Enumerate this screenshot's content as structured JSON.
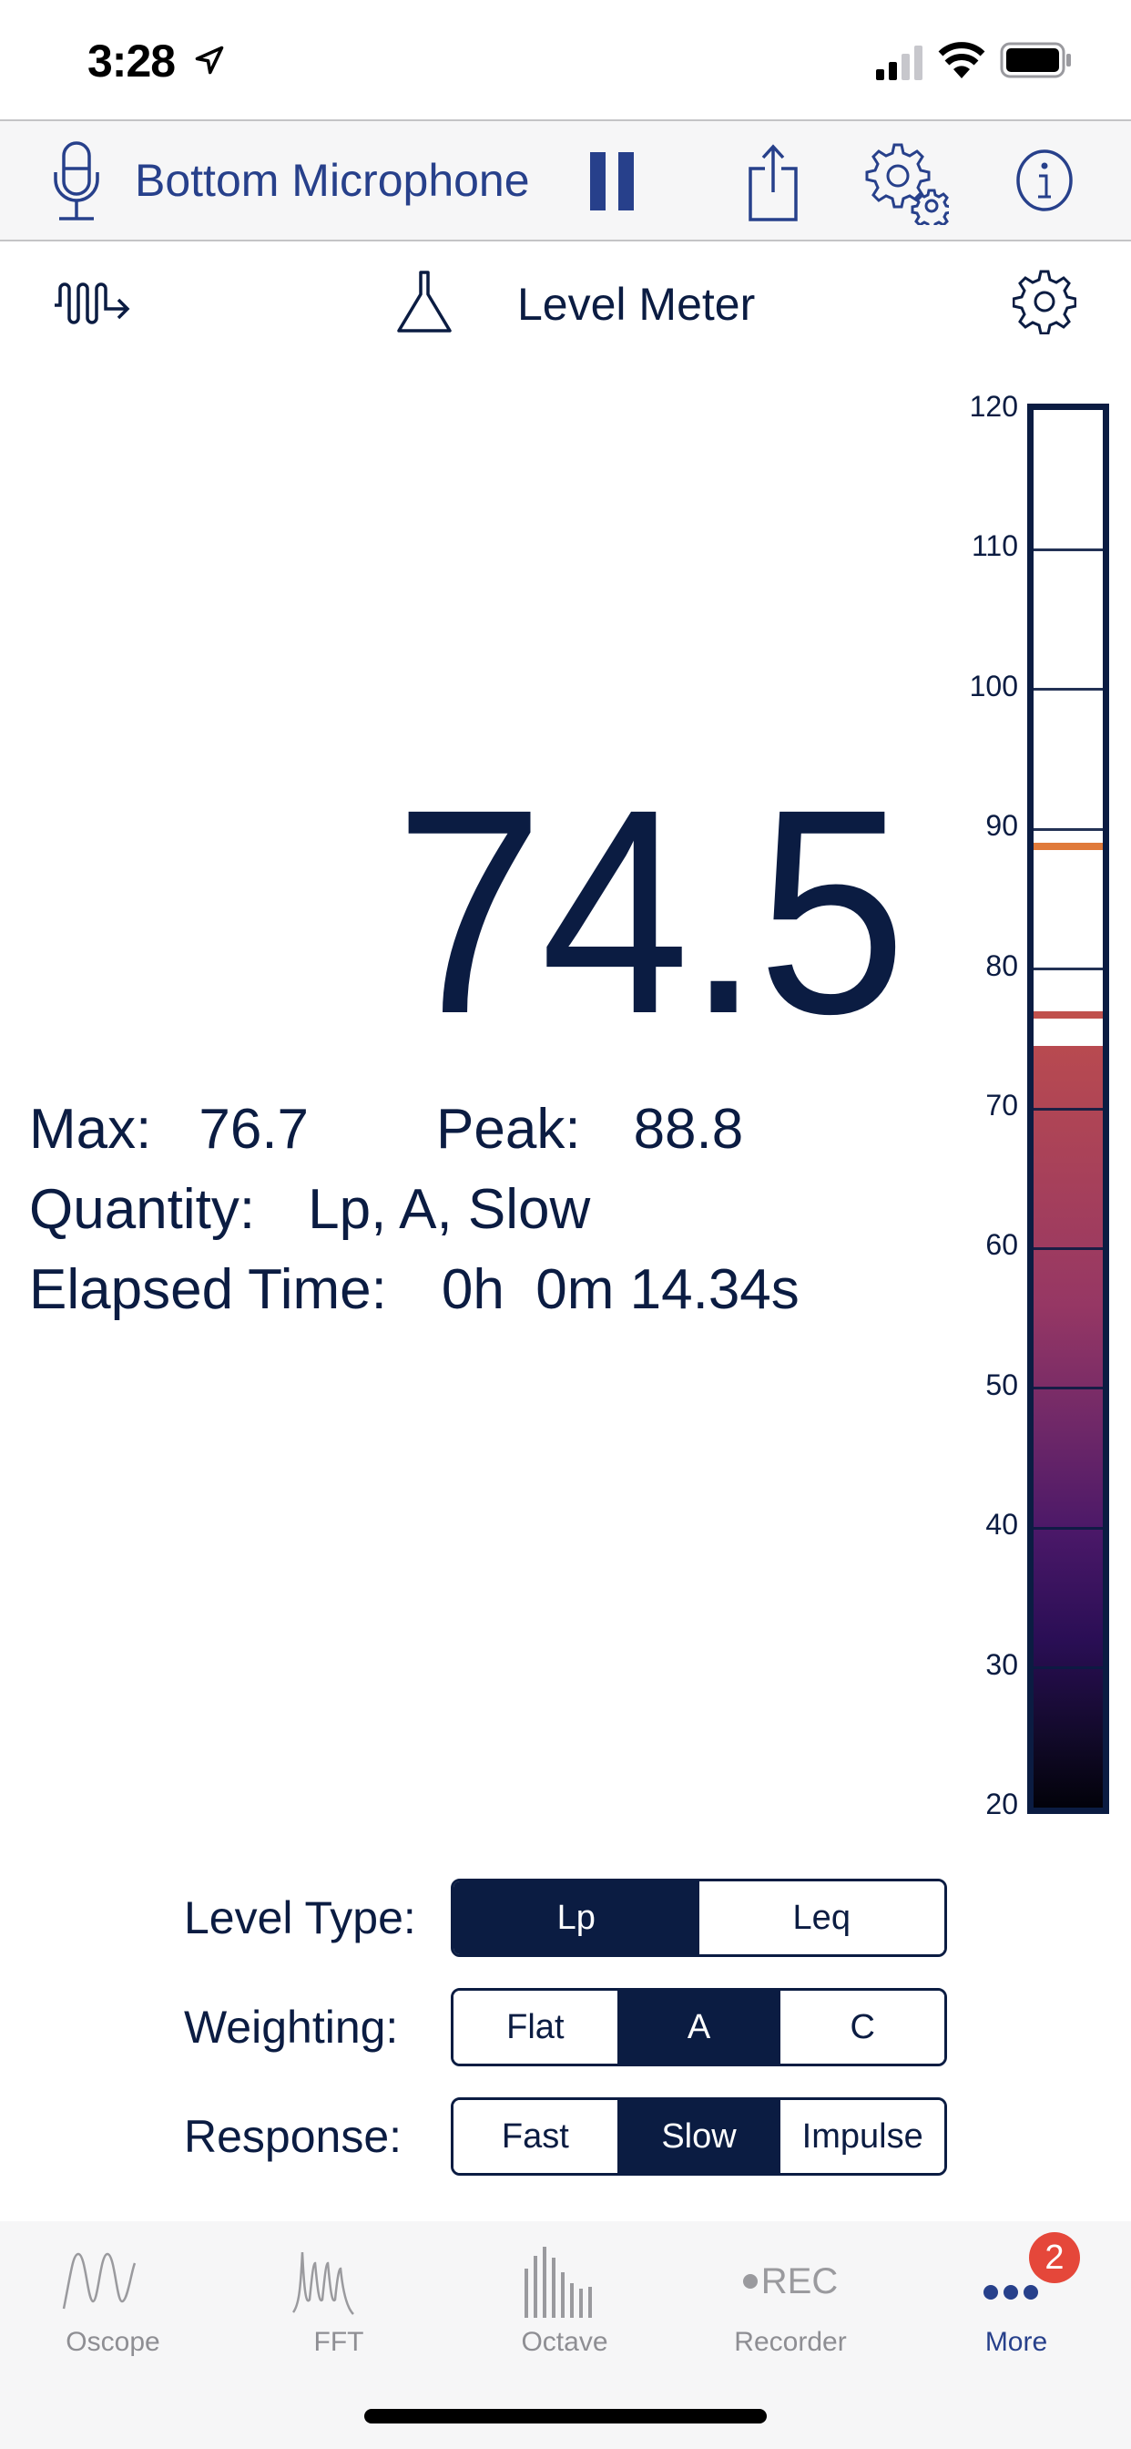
{
  "status_bar": {
    "time": "3:28"
  },
  "toolbar": {
    "input_source": "Bottom Microphone",
    "accent_color": "#27408b"
  },
  "subheader": {
    "title": "Level Meter"
  },
  "reading": {
    "value": "74.5"
  },
  "stats": {
    "max_label": "Max:",
    "max_value": "76.7",
    "peak_label": "Peak:",
    "peak_value": "88.8",
    "quantity_label": "Quantity:",
    "quantity_value": "Lp, A, Slow",
    "elapsed_label": "Elapsed Time:",
    "elapsed_value": "0h  0m 14.34s"
  },
  "meter": {
    "min": 20,
    "max": 120,
    "current": 74.5,
    "max_marker": 76.7,
    "peak_marker": 88.8,
    "max_marker_color": "#c0514d",
    "peak_marker_color": "#e07a3a",
    "ticks": [
      "120",
      "110",
      "100",
      "90",
      "80",
      "70",
      "60",
      "50",
      "40",
      "30",
      "20"
    ]
  },
  "controls": {
    "level_type": {
      "label": "Level Type:",
      "options": [
        "Lp",
        "Leq"
      ],
      "selected": "Lp"
    },
    "weighting": {
      "label": "Weighting:",
      "options": [
        "Flat",
        "A",
        "C"
      ],
      "selected": "A"
    },
    "response": {
      "label": "Response:",
      "options": [
        "Fast",
        "Slow",
        "Impulse"
      ],
      "selected": "Slow"
    }
  },
  "tabbar": {
    "tabs": [
      {
        "label": "Oscope",
        "icon": "oscope-wave-icon"
      },
      {
        "label": "FFT",
        "icon": "fft-peaks-icon"
      },
      {
        "label": "Octave",
        "icon": "octave-bars-icon"
      },
      {
        "label": "Recorder",
        "icon": "rec-icon",
        "icon_text": "REC"
      },
      {
        "label": "More",
        "icon": "more-dots-icon",
        "active": true,
        "badge": "2"
      }
    ]
  }
}
